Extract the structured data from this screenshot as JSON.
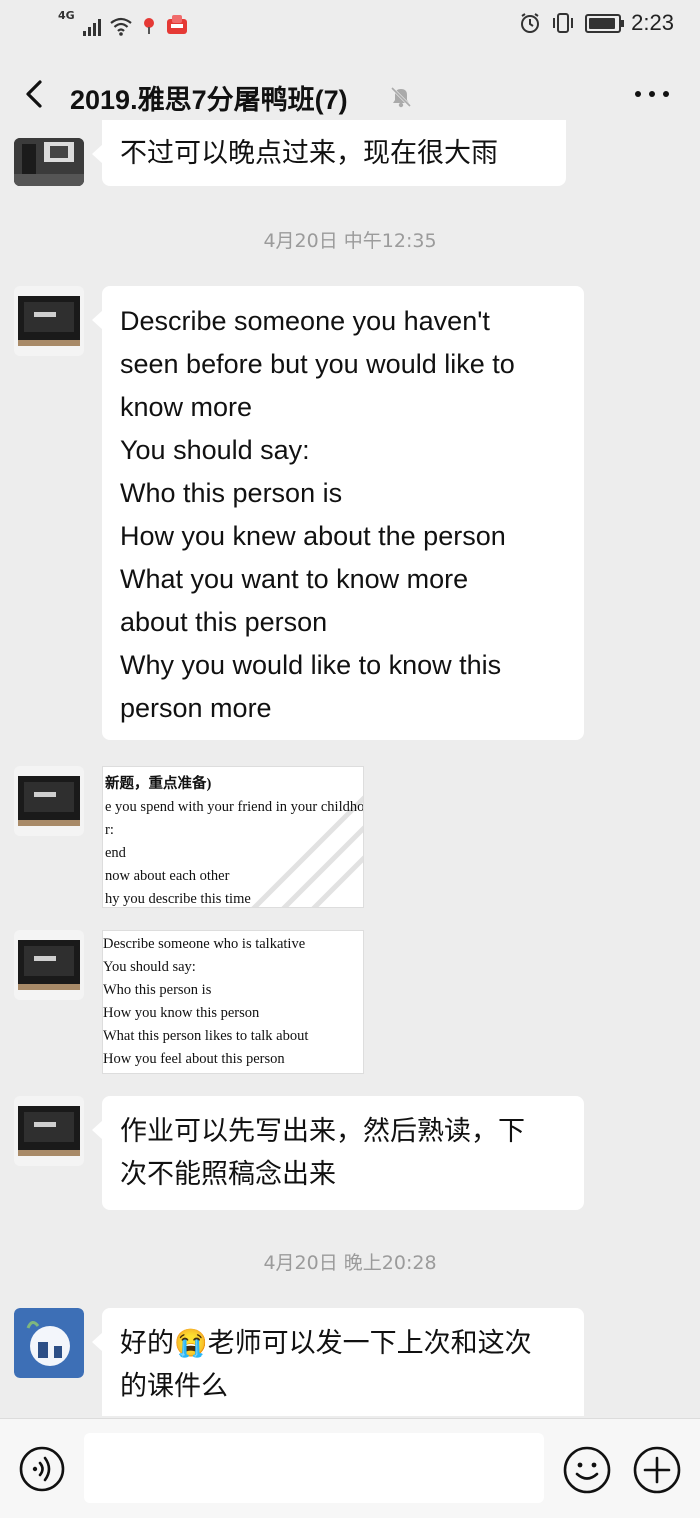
{
  "status_bar": {
    "network": "4G",
    "time": "2:23",
    "icons": [
      "signal-icon",
      "wifi-icon",
      "location-icon",
      "notification-icon",
      "alarm-icon",
      "vibrate-icon",
      "battery-icon"
    ]
  },
  "header": {
    "title": "2019.雅思7分屠鸭班(7)",
    "icons": [
      "back-icon",
      "mute-icon",
      "more-icon"
    ]
  },
  "messages": [
    {
      "type": "text",
      "lines": [
        "不过可以晚点过来，现在很大雨"
      ]
    },
    {
      "type": "time",
      "text": "4月20日 中午12:35"
    },
    {
      "type": "text",
      "lines": [
        "Describe someone you haven't",
        "seen before but you would like to",
        "know more",
        "You should say:",
        "Who this person is",
        "How you knew about the person",
        "What you want to know more",
        "about this person",
        "Why you would like to know this",
        "person more"
      ]
    },
    {
      "type": "image",
      "lines": [
        "新题，重点准备)",
        "e you spend with your friend in your childho",
        "r:",
        "end",
        "now about each other",
        "hy you describe this time"
      ]
    },
    {
      "type": "image",
      "lines": [
        "Describe someone who is talkative",
        "You should say:",
        "Who this person is",
        "How you know this person",
        "What this person likes to talk about",
        "How you feel about this person"
      ]
    },
    {
      "type": "text",
      "lines": [
        "作业可以先写出来，然后熟读，下",
        "次不能照稿念出来"
      ]
    },
    {
      "type": "time",
      "text": "4月20日 晚上20:28"
    },
    {
      "type": "text",
      "lines": [
        "好的😭老师可以发一下上次和这次",
        "的课件么"
      ]
    }
  ],
  "input": {
    "value": "",
    "placeholder": ""
  },
  "bottom_icons": [
    "voice-icon",
    "emoji-icon",
    "plus-icon"
  ],
  "colors": {
    "background": "#ededed",
    "bubble": "#ffffff",
    "timestamp": "#9b9b9b"
  }
}
